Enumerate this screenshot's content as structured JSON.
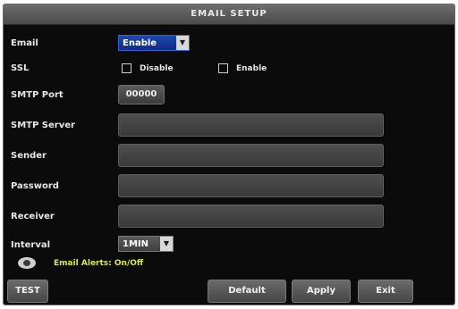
{
  "window": {
    "title": "EMAIL SETUP"
  },
  "email": {
    "label": "Email",
    "value": "Enable"
  },
  "ssl": {
    "label": "SSL",
    "option_disable": "Disable",
    "option_enable": "Enable"
  },
  "smtp_port": {
    "label": "SMTP Port",
    "value": "00000"
  },
  "smtp_server": {
    "label": "SMTP Server",
    "value": ""
  },
  "sender": {
    "label": "Sender",
    "value": ""
  },
  "password": {
    "label": "Password",
    "value": ""
  },
  "receiver": {
    "label": "Receiver",
    "value": ""
  },
  "interval": {
    "label": "Interval",
    "value": "1MIN"
  },
  "alerts": {
    "text": "Email Alerts: On/Off"
  },
  "buttons": {
    "test": "TEST",
    "default": "Default",
    "apply": "Apply",
    "exit": "Exit"
  },
  "icons": {
    "dropdown": "chevron-down-icon",
    "alerts": "eye-icon"
  }
}
